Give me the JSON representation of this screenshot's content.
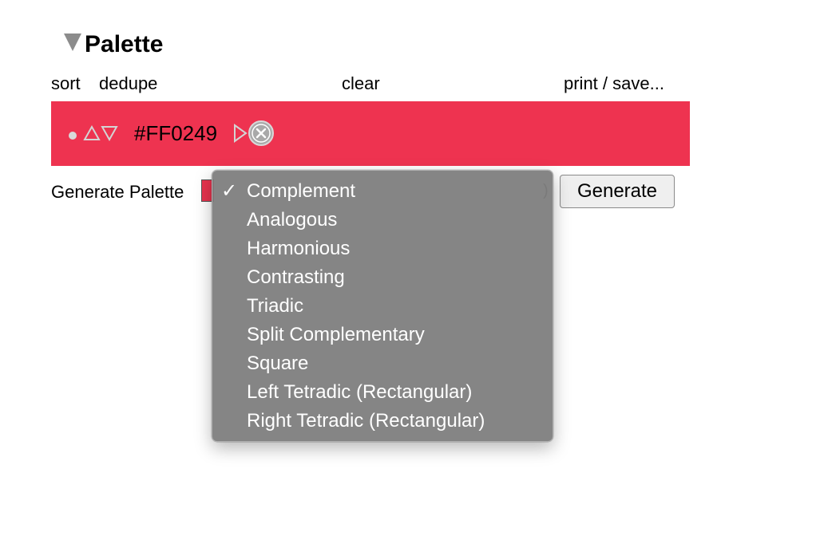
{
  "palette": {
    "title": "Palette",
    "toolbar": {
      "sort": "sort",
      "dedupe": "dedupe",
      "clear": "clear",
      "print_save": "print / save..."
    },
    "colors": [
      {
        "hex": "#FF0249",
        "background": "#EE3350"
      }
    ]
  },
  "generate": {
    "label": "Generate Palette",
    "swatch_color": "#E8344F",
    "selected_option": "Complement",
    "options": [
      "Complement",
      "Analogous",
      "Harmonious",
      "Contrasting",
      "Triadic",
      "Split Complementary",
      "Square",
      "Left Tetradic (Rectangular)",
      "Right Tetradic (Rectangular)"
    ],
    "select_tail_glyph": ")",
    "button_label": "Generate"
  },
  "icons": {
    "disclosure": "disclosure-triangle-down-icon",
    "dot": "dot-icon",
    "move_up": "triangle-up-icon",
    "move_down": "triangle-down-icon",
    "play": "play-icon",
    "remove": "close-circle-icon",
    "check": "checkmark-icon"
  },
  "check_glyph": "✓"
}
